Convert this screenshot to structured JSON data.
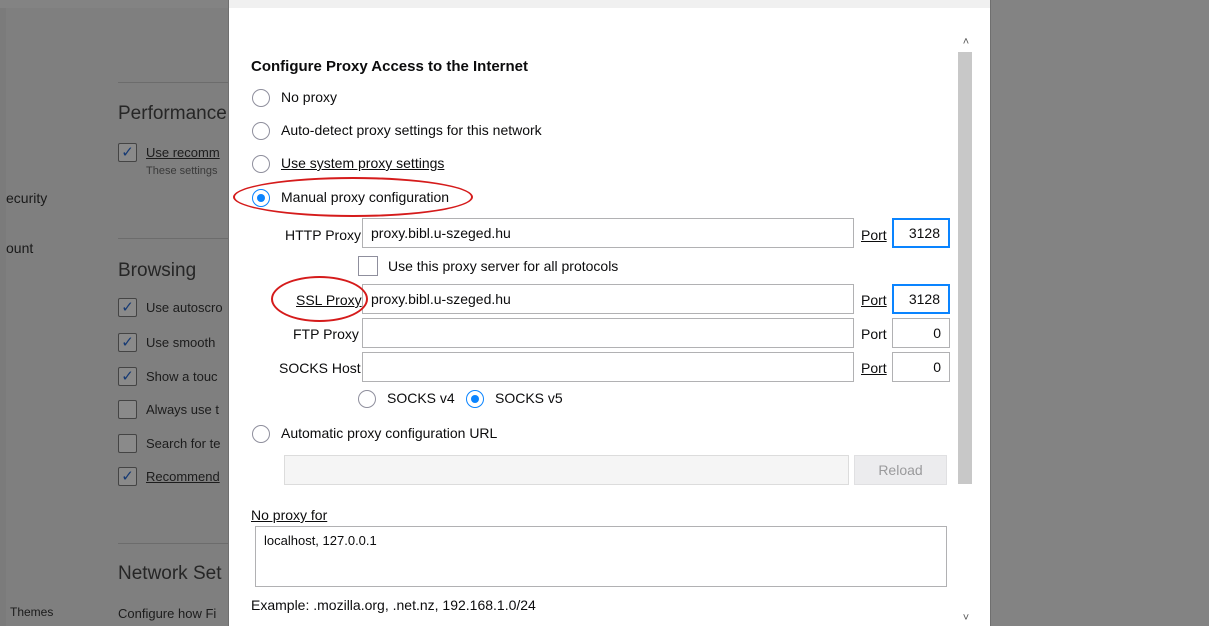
{
  "background": {
    "sidebar": {
      "security": "ecurity",
      "account": "ount",
      "themes": "Themes"
    },
    "sections": {
      "performance": {
        "heading": "Performance",
        "checkbox_label": "Use recomm",
        "note": "These settings"
      },
      "browsing": {
        "heading": "Browsing",
        "items": [
          {
            "label": "Use autoscro",
            "checked": true
          },
          {
            "label": "Use smooth",
            "checked": true
          },
          {
            "label": "Show a touc",
            "checked": true
          },
          {
            "label": "Always use t",
            "checked": false
          },
          {
            "label": "Search for te",
            "checked": false
          },
          {
            "label": "Recommend",
            "checked": true
          }
        ]
      },
      "network": {
        "heading": "Network Set",
        "description": "Configure how Fi"
      }
    }
  },
  "dialog": {
    "title": "Configure Proxy Access to the Internet",
    "options": {
      "no_proxy": "No proxy",
      "auto_detect": "Auto-detect proxy settings for this network",
      "system": "Use system proxy settings",
      "manual": "Manual proxy configuration",
      "auto_url": "Automatic proxy configuration URL"
    },
    "selected_option": "manual",
    "http_proxy": {
      "label": "HTTP Proxy",
      "value": "proxy.bibl.u-szeged.hu",
      "port_label": "Port",
      "port": "3128"
    },
    "use_for_all": {
      "label": "Use this proxy server for all protocols",
      "checked": false
    },
    "ssl_proxy": {
      "label": "SSL Proxy",
      "value": "proxy.bibl.u-szeged.hu",
      "port_label": "Port",
      "port": "3128"
    },
    "ftp_proxy": {
      "label": "FTP Proxy",
      "value": "",
      "port_label": "Port",
      "port": "0"
    },
    "socks_host": {
      "label": "SOCKS Host",
      "value": "",
      "port_label": "Port",
      "port": "0"
    },
    "socks_versions": {
      "v4": "SOCKS v4",
      "v5": "SOCKS v5",
      "selected": "v5"
    },
    "auto_url_value": "",
    "reload_button": "Reload",
    "no_proxy_for": {
      "label": "No proxy for",
      "value": "localhost, 127.0.0.1"
    },
    "example": "Example: .mozilla.org, .net.nz, 192.168.1.0/24"
  },
  "colors": {
    "accent": "#0a84ff",
    "annotation": "#d51b1b",
    "overlay": "#838383"
  }
}
